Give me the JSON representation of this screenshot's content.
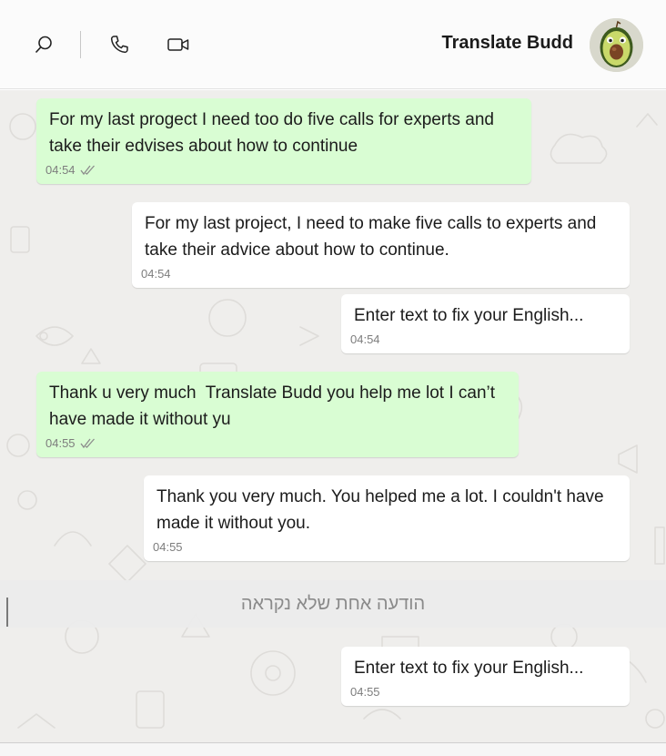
{
  "header": {
    "title": "Translate Budd",
    "icons": [
      "search-icon",
      "phone-icon",
      "video-camera-icon"
    ],
    "avatar": "avocado-avatar"
  },
  "messages": [
    {
      "direction": "outgoing",
      "text": "For my last progect I need too do five calls for experts and take their edvises about how to continue",
      "time": "04:54",
      "status": "read"
    },
    {
      "direction": "incoming",
      "text": "For my last project, I need to make five calls to experts and take their advice about how to continue.",
      "time": "04:54"
    },
    {
      "direction": "incoming",
      "text": "Enter text to fix your English...",
      "time": "04:54"
    },
    {
      "direction": "outgoing",
      "text": "Thank u very much  Translate Budd you help me lot I can’t have made it without yu",
      "time": "04:55",
      "status": "read"
    },
    {
      "direction": "incoming",
      "text": "Thank you very much. You helped me a lot. I couldn't have made it without you.",
      "time": "04:55"
    },
    {
      "direction": "incoming",
      "text": "Enter text to fix your English...",
      "time": "04:55"
    }
  ],
  "unread_divider": "הודעה אחת שלא נקראה",
  "colors": {
    "outgoing_bubble": "#d9fdd3",
    "incoming_bubble": "#ffffff",
    "chat_background": "#efeeec"
  }
}
